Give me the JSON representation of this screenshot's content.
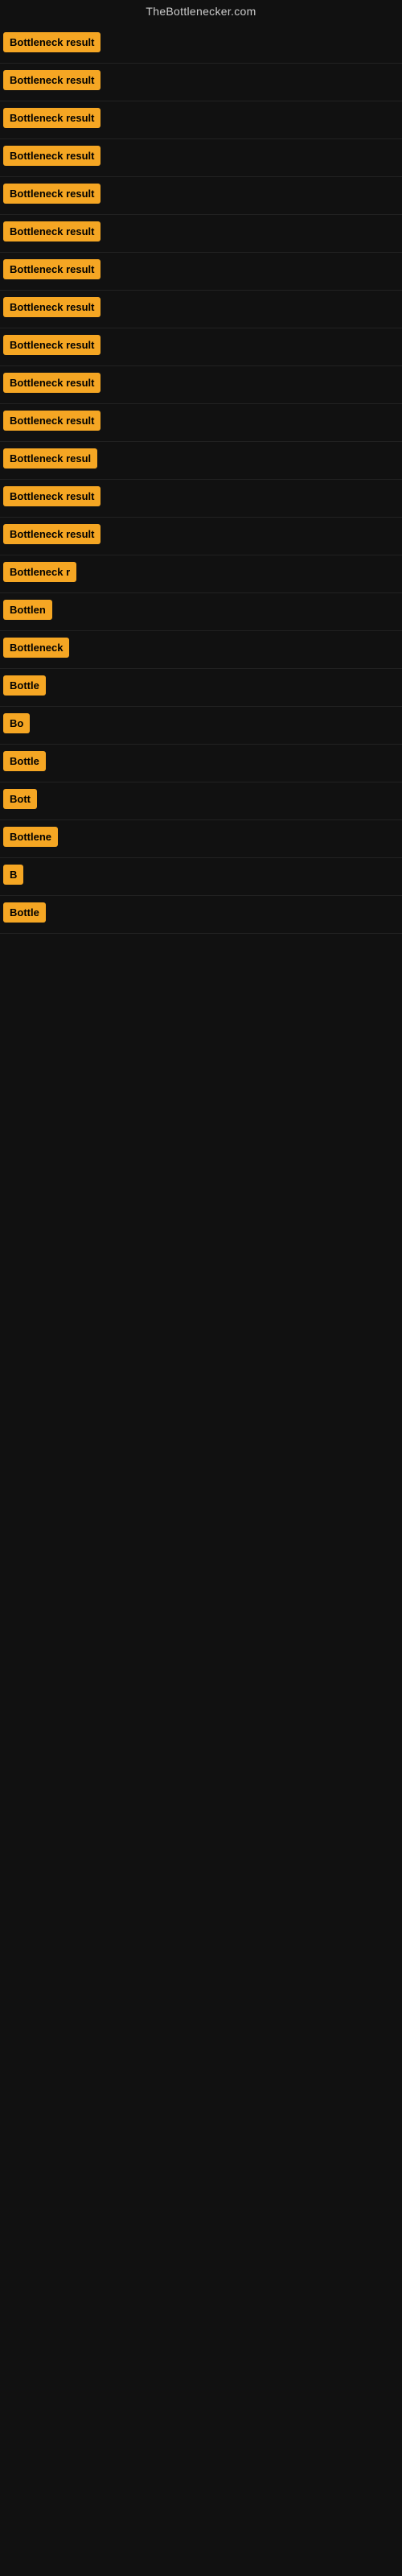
{
  "site": {
    "title": "TheBottlenecker.com"
  },
  "results": [
    {
      "id": 1,
      "label": "Bottleneck result",
      "visible_text": "Bottleneck result"
    },
    {
      "id": 2,
      "label": "Bottleneck result",
      "visible_text": "Bottleneck result"
    },
    {
      "id": 3,
      "label": "Bottleneck result",
      "visible_text": "Bottleneck result"
    },
    {
      "id": 4,
      "label": "Bottleneck result",
      "visible_text": "Bottleneck result"
    },
    {
      "id": 5,
      "label": "Bottleneck result",
      "visible_text": "Bottleneck result"
    },
    {
      "id": 6,
      "label": "Bottleneck result",
      "visible_text": "Bottleneck result"
    },
    {
      "id": 7,
      "label": "Bottleneck result",
      "visible_text": "Bottleneck result"
    },
    {
      "id": 8,
      "label": "Bottleneck result",
      "visible_text": "Bottleneck result"
    },
    {
      "id": 9,
      "label": "Bottleneck result",
      "visible_text": "Bottleneck result"
    },
    {
      "id": 10,
      "label": "Bottleneck result",
      "visible_text": "Bottleneck result"
    },
    {
      "id": 11,
      "label": "Bottleneck result",
      "visible_text": "Bottleneck result"
    },
    {
      "id": 12,
      "label": "Bottleneck resul",
      "visible_text": "Bottleneck resul"
    },
    {
      "id": 13,
      "label": "Bottleneck result",
      "visible_text": "Bottleneck result"
    },
    {
      "id": 14,
      "label": "Bottleneck result",
      "visible_text": "Bottleneck result"
    },
    {
      "id": 15,
      "label": "Bottleneck r",
      "visible_text": "Bottleneck r"
    },
    {
      "id": 16,
      "label": "Bottlen",
      "visible_text": "Bottlen"
    },
    {
      "id": 17,
      "label": "Bottleneck",
      "visible_text": "Bottleneck"
    },
    {
      "id": 18,
      "label": "Bottle",
      "visible_text": "Bottle"
    },
    {
      "id": 19,
      "label": "Bo",
      "visible_text": "Bo"
    },
    {
      "id": 20,
      "label": "Bottle",
      "visible_text": "Bottle"
    },
    {
      "id": 21,
      "label": "Bott",
      "visible_text": "Bott"
    },
    {
      "id": 22,
      "label": "Bottlene",
      "visible_text": "Bottlene"
    },
    {
      "id": 23,
      "label": "B",
      "visible_text": "B"
    },
    {
      "id": 24,
      "label": "Bottle",
      "visible_text": "Bottle"
    }
  ]
}
